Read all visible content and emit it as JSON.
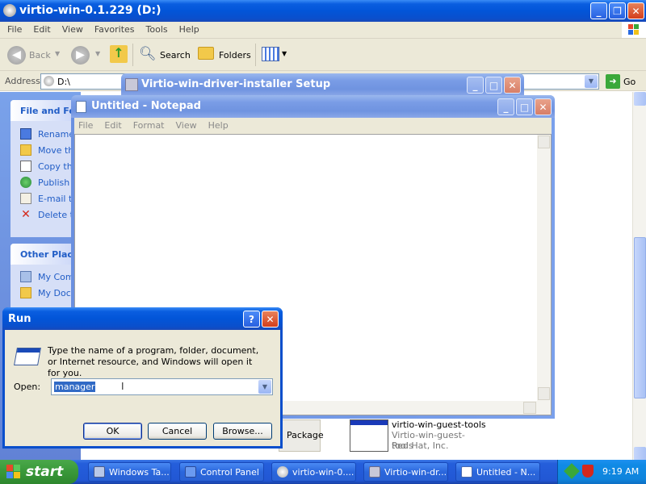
{
  "explorer": {
    "title": "virtio-win-0.1.229 (D:)",
    "menu": [
      "File",
      "Edit",
      "View",
      "Favorites",
      "Tools",
      "Help"
    ],
    "toolbar": {
      "back": "Back",
      "search": "Search",
      "folders": "Folders"
    },
    "address_label": "Address",
    "address_value": "D:\\",
    "go_label": "Go",
    "file_folder_tasks": "File and Fol",
    "tasks": [
      "Rename",
      "Move th",
      "Copy thi",
      "Publish t",
      "E-mail th",
      "Delete th"
    ],
    "other_places": "Other Place",
    "places": [
      "My Comp",
      "My Docu"
    ],
    "file_item": {
      "name": "virtio-win-guest-tools",
      "desc": "Virtio-win-guest-tools",
      "company": "Red Hat, Inc."
    },
    "package_text": "Package"
  },
  "setup": {
    "title": "Virtio-win-driver-installer Setup"
  },
  "notepad": {
    "title": "Untitled - Notepad",
    "menu": [
      "File",
      "Edit",
      "Format",
      "View",
      "Help"
    ]
  },
  "run": {
    "title": "Run",
    "help": "?",
    "description": "Type the name of a program, folder, document, or Internet resource, and Windows will open it for you.",
    "open_label": "Open:",
    "open_value": "manager",
    "ok": "OK",
    "cancel": "Cancel",
    "browse": "Browse..."
  },
  "taskbar": {
    "start": "start",
    "buttons": [
      "Windows Ta...",
      "Control Panel",
      "virtio-win-0....",
      "Virtio-win-dr...",
      "Untitled - N..."
    ],
    "clock": "9:19 AM"
  },
  "colors": {
    "xp_blue": "#0a5ee0",
    "taskbar": "#245edb",
    "start_green": "#3c9b3c",
    "sidebar": "#6b8fe0",
    "link": "#215dc6"
  }
}
